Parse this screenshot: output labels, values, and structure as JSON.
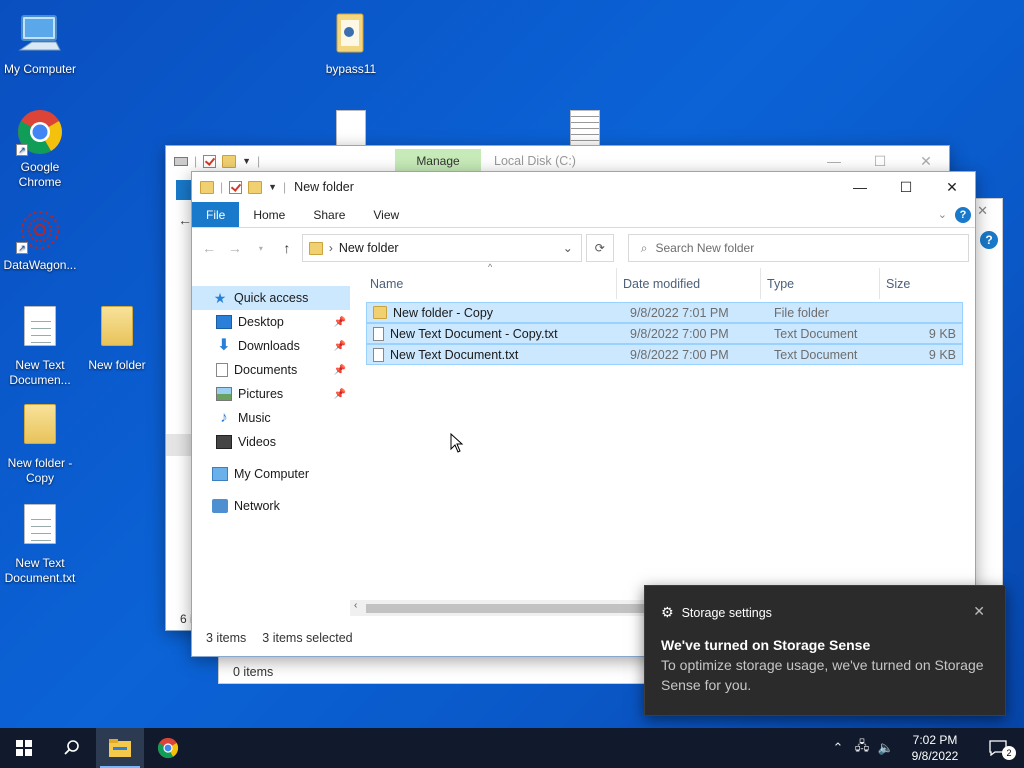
{
  "desktop": {
    "icons": [
      {
        "label": "My Computer",
        "icon": "computer-icon"
      },
      {
        "label": "Google Chrome",
        "icon": "chrome-icon"
      },
      {
        "label": "DataWagon...",
        "icon": "datawagon-icon"
      },
      {
        "label": "New Text Documen...",
        "icon": "text-document-icon"
      },
      {
        "label": "New folder",
        "icon": "folder-icon"
      },
      {
        "label": "New folder - Copy",
        "icon": "folder-icon"
      },
      {
        "label": "New Text Document.txt",
        "icon": "text-document-icon"
      },
      {
        "label": "bypass11",
        "icon": "folder-icon"
      }
    ]
  },
  "back_window": {
    "contextual_tab": "Manage",
    "title": "Local Disk (C:)",
    "status_partial": "6 i"
  },
  "window": {
    "title": "New folder",
    "ribbon_tabs": [
      "File",
      "Home",
      "Share",
      "View"
    ],
    "address": "New folder",
    "search_placeholder": "Search New folder",
    "nav": {
      "quick_access": "Quick access",
      "items": [
        {
          "label": "Desktop",
          "pinned": true
        },
        {
          "label": "Downloads",
          "pinned": true
        },
        {
          "label": "Documents",
          "pinned": true
        },
        {
          "label": "Pictures",
          "pinned": true
        },
        {
          "label": "Music",
          "pinned": false
        },
        {
          "label": "Videos",
          "pinned": false
        }
      ],
      "my_computer": "My Computer",
      "network": "Network"
    },
    "columns": [
      "Name",
      "Date modified",
      "Type",
      "Size"
    ],
    "files": [
      {
        "name": "New folder - Copy",
        "date": "9/8/2022 7:01 PM",
        "type": "File folder",
        "size": ""
      },
      {
        "name": "New Text Document - Copy.txt",
        "date": "9/8/2022 7:00 PM",
        "type": "Text Document",
        "size": "9 KB"
      },
      {
        "name": "New Text Document.txt",
        "date": "9/8/2022 7:00 PM",
        "type": "Text Document",
        "size": "9 KB"
      }
    ],
    "status_items": "3 items",
    "status_selected": "3 items selected"
  },
  "third_window": {
    "status": "0 items"
  },
  "toast": {
    "app": "Storage settings",
    "title": "We've turned on Storage Sense",
    "message": "To optimize storage usage, we've turned on Storage Sense for you."
  },
  "taskbar": {
    "time": "7:02 PM",
    "date": "9/8/2022",
    "notification_count": "2"
  },
  "colors": {
    "accent": "#1979ca",
    "selection": "#cce8ff",
    "taskbar": "#101a2c",
    "toast_bg": "#2b2b2b"
  }
}
